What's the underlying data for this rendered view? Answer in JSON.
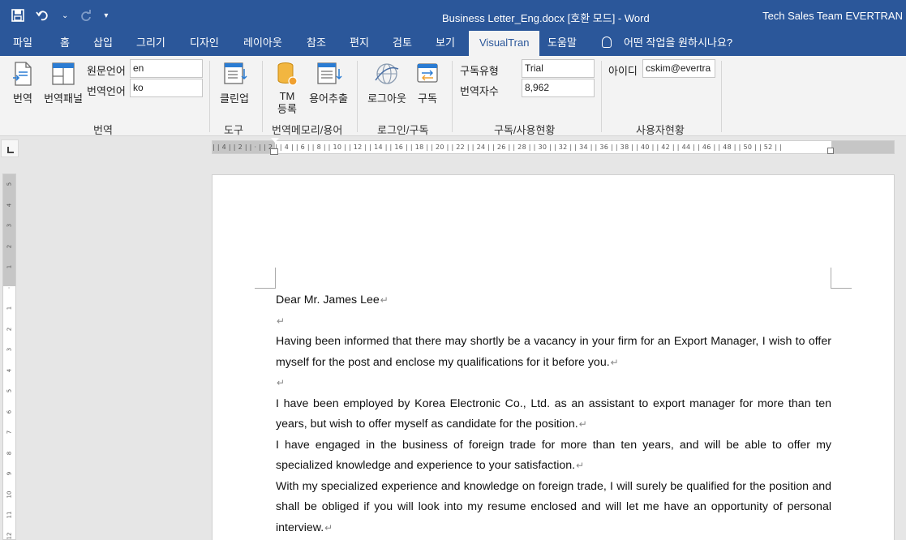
{
  "titlebar": {
    "doc_title": "Business Letter_Eng.docx [호환 모드]  -  Word",
    "account": "Tech Sales Team EVERTRAN",
    "qat": {
      "save_icon": "💾",
      "undo_icon": "↶",
      "dropdown_icon": "⌄",
      "redo_icon": "↻",
      "customize_icon": "▾"
    }
  },
  "tabs": {
    "file": "파일",
    "home": "홈",
    "insert": "삽입",
    "draw": "그리기",
    "design": "디자인",
    "layout": "레이아웃",
    "references": "참조",
    "mailings": "편지",
    "review": "검토",
    "view": "보기",
    "visualtran": "VisualTran",
    "help": "도움말",
    "tell_me": "어떤 작업을 원하시나요?"
  },
  "ribbon": {
    "translate": "번역",
    "translate_panel": "번역패널",
    "source_lang_label": "원문언어",
    "source_lang_value": "en",
    "target_lang_label": "번역언어",
    "target_lang_value": "ko",
    "group_translate": "번역",
    "cleanup": "클린업",
    "group_tools": "도구",
    "tm_register_line1": "TM",
    "tm_register_line2": "등록",
    "term_extract": "용어추출",
    "group_tm": "번역메모리/용어",
    "logout": "로그아웃",
    "subscribe": "구독",
    "group_login": "로그인/구독",
    "sub_type_label": "구독유형",
    "sub_type_value": "Trial",
    "trans_count_label": "번역자수",
    "trans_count_value": "8,962",
    "group_subscription": "구독/사용현황",
    "id_label": "아이디",
    "id_value": "cskim@evertra",
    "group_user": "사용자현황"
  },
  "ruler": {
    "ticks": "|  | 4 |  | 2 |  |  ·  |  | 2 |  | 4 |  | 6 |  | 8 |  | 10 |  | 12 |  | 14 |  | 16 |  | 18 |  | 20 |  | 22 |  | 24 |  | 26 |  | 28 |  | 30 |  | 32 |  | 34 |  | 36 |  | 38 |  | 40 |  | 42 |  | 44 |  | 46 |  | 48 |  | 50 |  | 52 |  |",
    "vertical": [
      "5",
      "4",
      "3",
      "2",
      "1",
      "·",
      "1",
      "2",
      "3",
      "4",
      "5",
      "6",
      "7",
      "8",
      "9",
      "10",
      "11",
      "12"
    ]
  },
  "document": {
    "salutation": "Dear Mr. James Lee",
    "para1": "Having been informed that there may shortly be a vacancy in your firm for an Export Manager, I wish to offer myself for the post and enclose my qualifications for it before you.",
    "para2": "I have been employed by Korea Electronic Co., Ltd. as an assistant to export manager for more than ten years, but wish to offer myself as candidate for the position.",
    "para3": "I have engaged in the business of foreign trade for more than ten years, and will be able to offer my specialized knowledge and experience to your satisfaction.",
    "para4": "With my specialized experience and knowledge on foreign trade, I will surely be qualified for the position and shall be obliged if you will look into my resume enclosed and will let me have an opportunity of personal interview.",
    "paragraph_mark": "↵"
  },
  "colors": {
    "word_blue": "#2b579a",
    "ribbon_bg": "#f3f3f3",
    "canvas_bg": "#e6e6e6"
  }
}
